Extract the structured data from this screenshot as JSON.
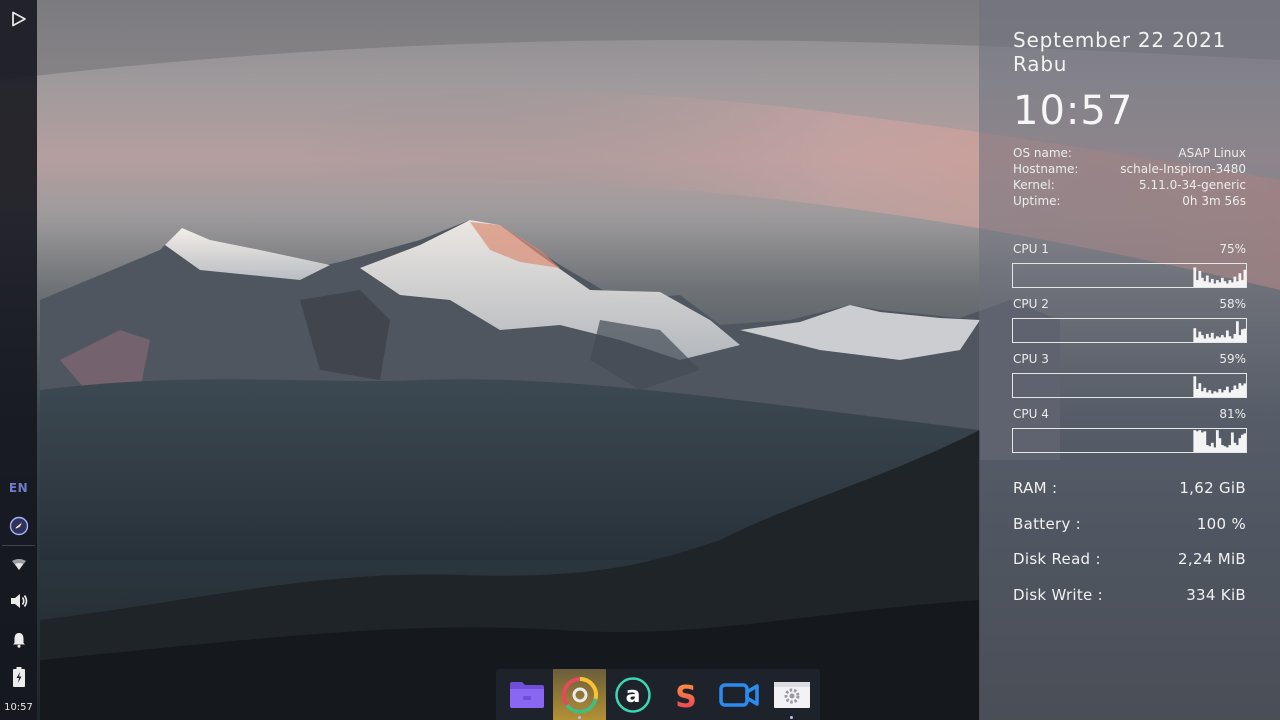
{
  "left_panel": {
    "items": [
      {
        "name": "play-icon"
      },
      {
        "name": "lang-indicator",
        "label": "EN"
      },
      {
        "name": "launcher-icon"
      },
      {
        "name": "wifi-icon"
      },
      {
        "name": "volume-icon"
      },
      {
        "name": "bell-icon"
      },
      {
        "name": "battery-icon"
      }
    ],
    "lang": "EN",
    "clock": "10:57"
  },
  "conky": {
    "date": "September 22 2021",
    "day": "Rabu",
    "time": "10:57",
    "system": [
      {
        "key": "OS name:",
        "value": "ASAP Linux"
      },
      {
        "key": "Hostname:",
        "value": "schale-Inspiron-3480"
      },
      {
        "key": "Kernel:",
        "value": "5.11.0-34-generic"
      },
      {
        "key": "Uptime:",
        "value": "0h 3m 56s"
      }
    ],
    "cpus": [
      {
        "name": "CPU 1",
        "percent": "75%",
        "history": [
          0,
          0,
          0,
          0,
          0,
          0,
          0,
          0,
          0,
          0,
          0,
          0,
          0,
          0,
          0,
          0,
          0,
          0,
          0,
          0,
          0,
          0,
          0,
          0,
          0,
          0,
          0,
          0,
          0,
          0,
          0,
          0,
          0,
          0,
          0,
          0,
          0,
          0,
          0,
          0,
          0,
          0,
          0,
          0,
          0,
          0,
          0,
          0,
          0,
          0,
          0,
          0,
          0,
          0,
          0,
          0,
          0,
          0,
          0,
          0,
          0,
          0,
          0,
          0,
          0,
          0,
          0,
          0,
          0,
          0,
          0,
          0,
          0.85,
          0.3,
          0.7,
          0.4,
          0.25,
          0.5,
          0.2,
          0.35,
          0.15,
          0.3,
          0.2,
          0.4,
          0.25,
          0.15,
          0.3,
          0.2,
          0.45,
          0.25,
          0.6,
          0.3,
          0.75
        ]
      },
      {
        "name": "CPU 2",
        "percent": "58%",
        "history": [
          0,
          0,
          0,
          0,
          0,
          0,
          0,
          0,
          0,
          0,
          0,
          0,
          0,
          0,
          0,
          0,
          0,
          0,
          0,
          0,
          0,
          0,
          0,
          0,
          0,
          0,
          0,
          0,
          0,
          0,
          0,
          0,
          0,
          0,
          0,
          0,
          0,
          0,
          0,
          0,
          0,
          0,
          0,
          0,
          0,
          0,
          0,
          0,
          0,
          0,
          0,
          0,
          0,
          0,
          0,
          0,
          0,
          0,
          0,
          0,
          0,
          0,
          0,
          0,
          0,
          0,
          0,
          0,
          0,
          0,
          0,
          0,
          0.6,
          0.2,
          0.45,
          0.3,
          0.15,
          0.35,
          0.2,
          0.4,
          0.15,
          0.25,
          0.2,
          0.3,
          0.2,
          0.5,
          0.25,
          0.15,
          0.35,
          0.9,
          0.3,
          0.55,
          0.58
        ]
      },
      {
        "name": "CPU 3",
        "percent": "59%",
        "history": [
          0,
          0,
          0,
          0,
          0,
          0,
          0,
          0,
          0,
          0,
          0,
          0,
          0,
          0,
          0,
          0,
          0,
          0,
          0,
          0,
          0,
          0,
          0,
          0,
          0,
          0,
          0,
          0,
          0,
          0,
          0,
          0,
          0,
          0,
          0,
          0,
          0,
          0,
          0,
          0,
          0,
          0,
          0,
          0,
          0,
          0,
          0,
          0,
          0,
          0,
          0,
          0,
          0,
          0,
          0,
          0,
          0,
          0,
          0,
          0,
          0,
          0,
          0,
          0,
          0,
          0,
          0,
          0,
          0,
          0,
          0,
          0,
          0.9,
          0.35,
          0.6,
          0.25,
          0.4,
          0.2,
          0.3,
          0.15,
          0.25,
          0.2,
          0.35,
          0.2,
          0.3,
          0.45,
          0.2,
          0.3,
          0.5,
          0.35,
          0.6,
          0.5,
          0.59
        ]
      },
      {
        "name": "CPU 4",
        "percent": "81%",
        "history": [
          0,
          0,
          0,
          0,
          0,
          0,
          0,
          0,
          0,
          0,
          0,
          0,
          0,
          0,
          0,
          0,
          0,
          0,
          0,
          0,
          0,
          0,
          0,
          0,
          0,
          0,
          0,
          0,
          0,
          0,
          0,
          0,
          0,
          0,
          0,
          0,
          0,
          0,
          0,
          0,
          0,
          0,
          0,
          0,
          0,
          0,
          0,
          0,
          0,
          0,
          0,
          0,
          0,
          0,
          0,
          0,
          0,
          0,
          0,
          0,
          0,
          0,
          0,
          0,
          0,
          0,
          0,
          0,
          0,
          0,
          0,
          0,
          0.95,
          0.9,
          0.95,
          0.85,
          0.9,
          0.3,
          0.25,
          0.4,
          0.2,
          0.95,
          0.6,
          0.3,
          0.25,
          0.2,
          0.3,
          0.85,
          0.4,
          0.3,
          0.6,
          0.75,
          0.81
        ]
      }
    ],
    "stats": [
      {
        "key": "RAM :",
        "value": "1,62 GiB"
      },
      {
        "key": "Battery :",
        "value": "100 %"
      },
      {
        "key": "Disk Read :",
        "value": "2,24 MiB"
      },
      {
        "key": "Disk Write :",
        "value": "334 KiB"
      }
    ]
  },
  "dock": {
    "apps": [
      {
        "name": "files",
        "icon": "folder-icon",
        "active": false
      },
      {
        "name": "chrome",
        "icon": "chrome-icon",
        "active": true
      },
      {
        "name": "appimage",
        "icon": "a-app-icon",
        "active": false
      },
      {
        "name": "slides",
        "icon": "s-app-icon",
        "active": false
      },
      {
        "name": "video",
        "icon": "camera-icon",
        "active": false
      },
      {
        "name": "settings",
        "icon": "gear-icon",
        "active": false
      }
    ]
  }
}
